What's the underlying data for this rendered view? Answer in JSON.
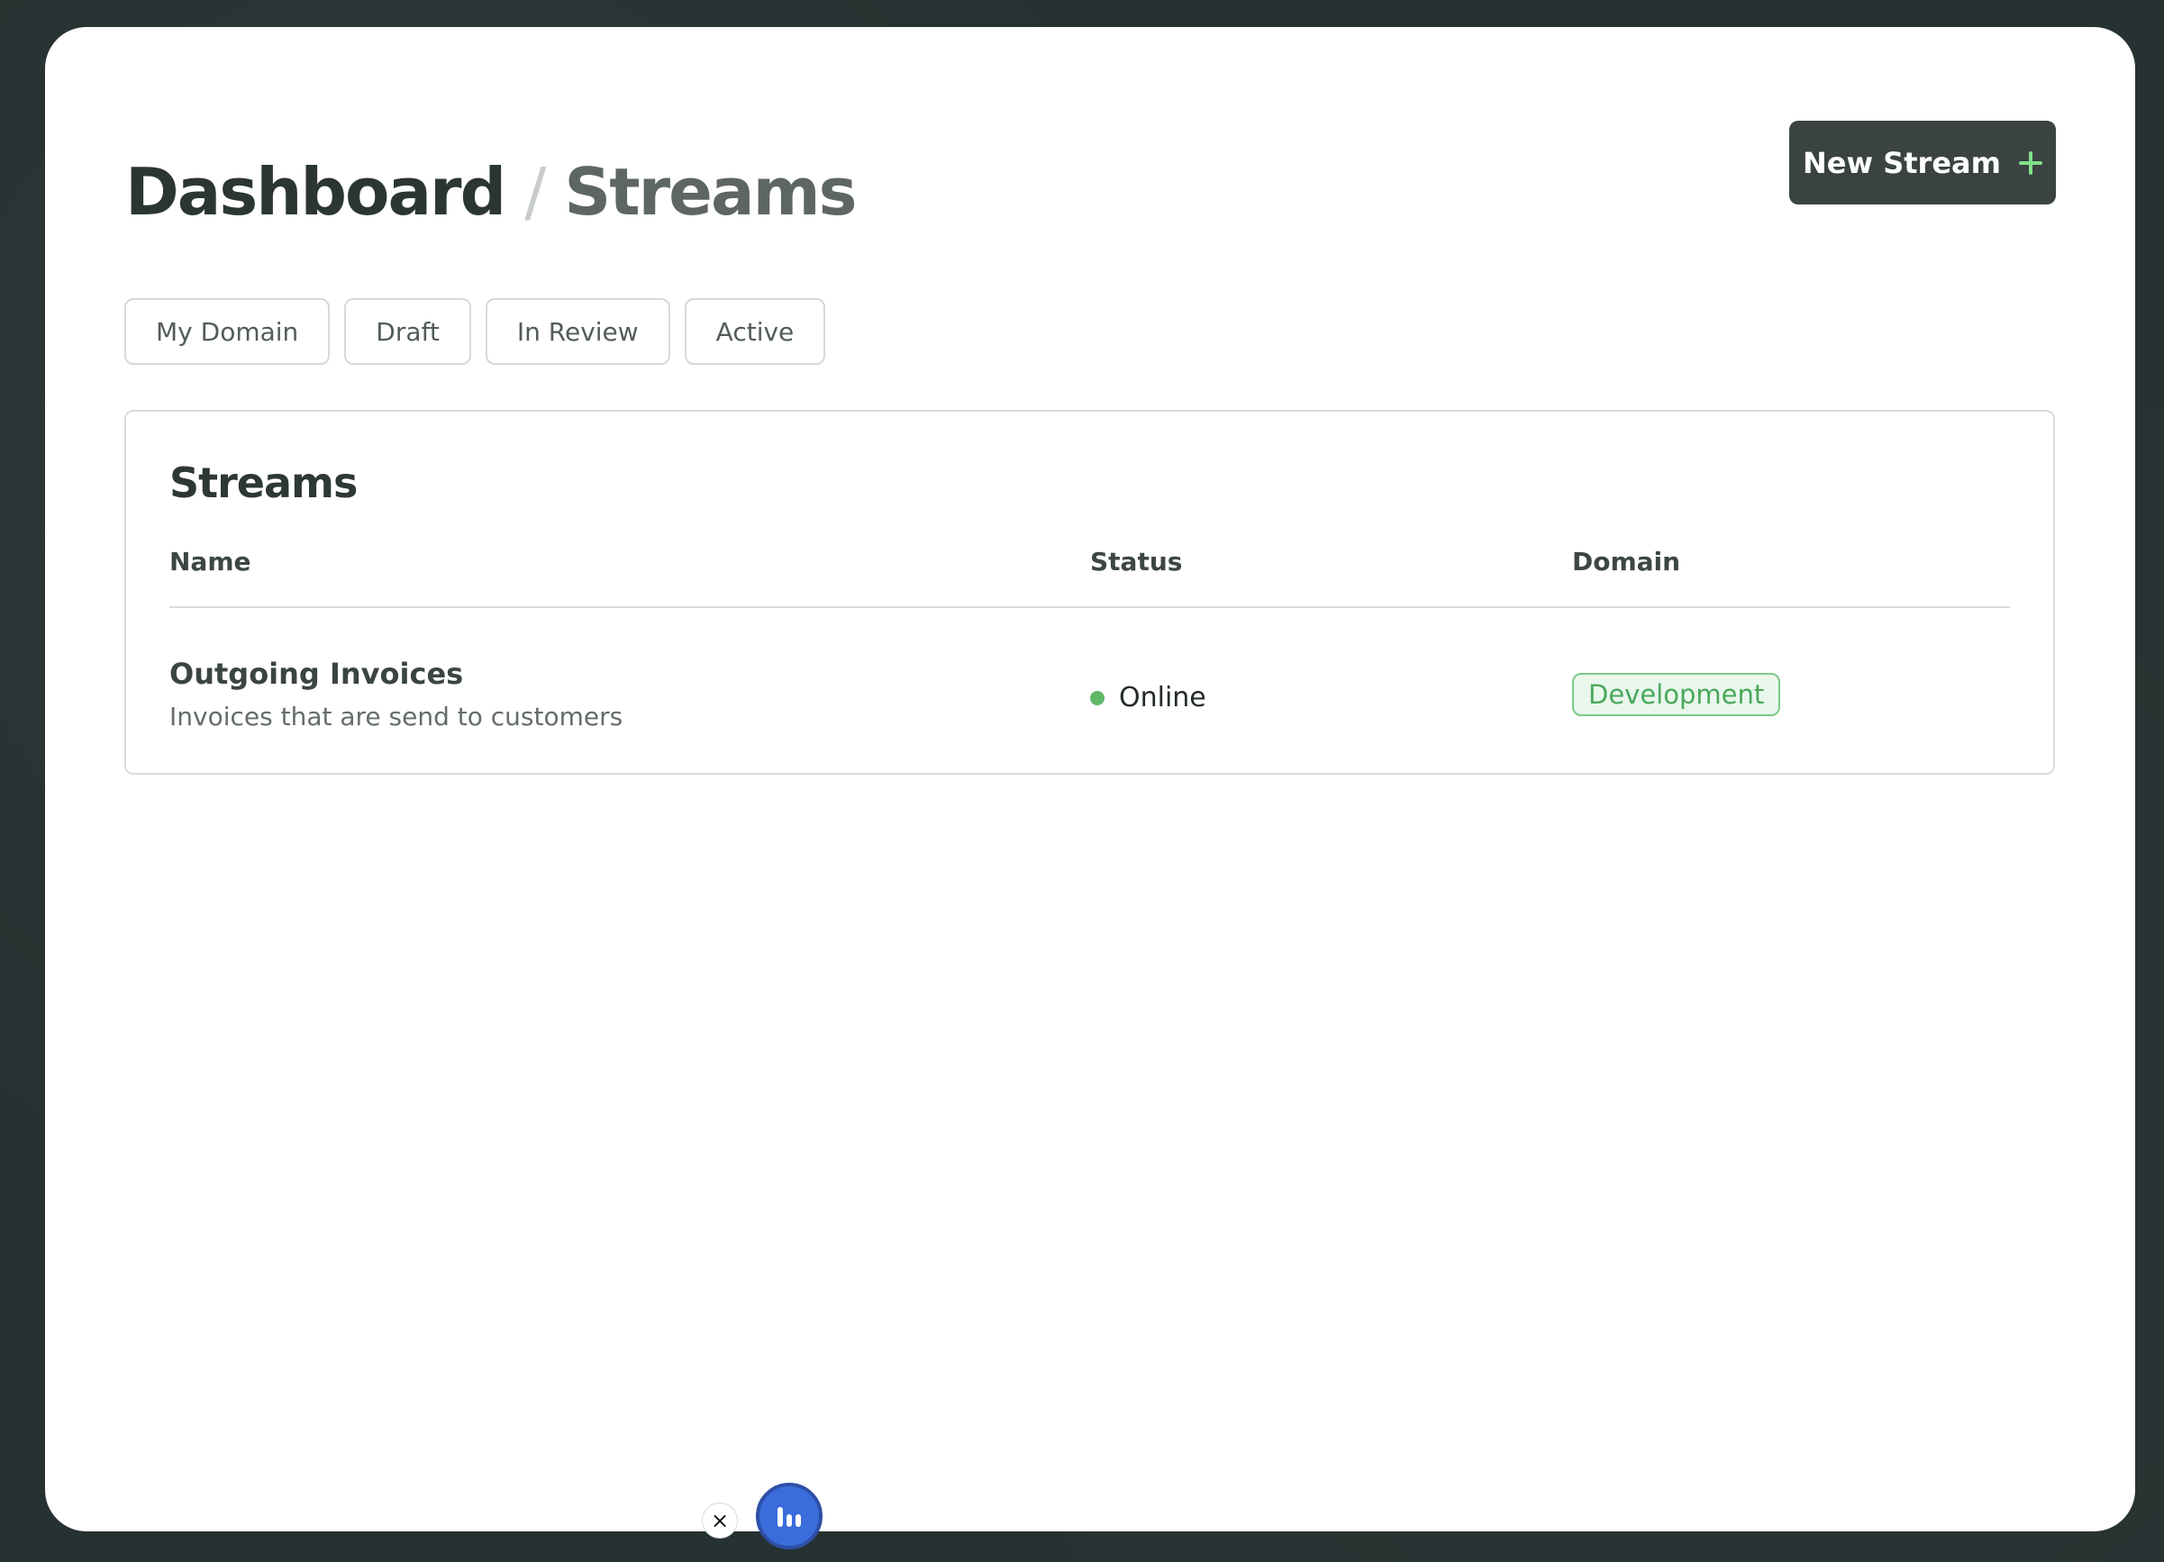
{
  "header": {
    "breadcrumb_root": "Dashboard",
    "breadcrumb_separator": "/",
    "breadcrumb_current": "Streams",
    "new_stream_label": "New Stream"
  },
  "filters": [
    {
      "label": "My Domain"
    },
    {
      "label": "Draft"
    },
    {
      "label": "In Review"
    },
    {
      "label": "Active"
    }
  ],
  "table": {
    "title": "Streams",
    "columns": {
      "name": "Name",
      "status": "Status",
      "domain": "Domain"
    },
    "rows": [
      {
        "name": "Outgoing Invoices",
        "description": "Invoices that are send to customers",
        "status": "Online",
        "domain": "Development"
      }
    ]
  },
  "floating": {
    "close_symbol": "×"
  },
  "colors": {
    "background": "#263231",
    "primary_button": "#3a4341",
    "accent_plus": "#7fe08a",
    "online_dot": "#5fb865",
    "domain_badge_border": "#7cc988",
    "domain_badge_text": "#49a85a",
    "fab": "#3a6ddb"
  },
  "icons": {
    "new_stream": "plus-icon",
    "fab": "bar-chart-icon",
    "close": "close-icon"
  }
}
